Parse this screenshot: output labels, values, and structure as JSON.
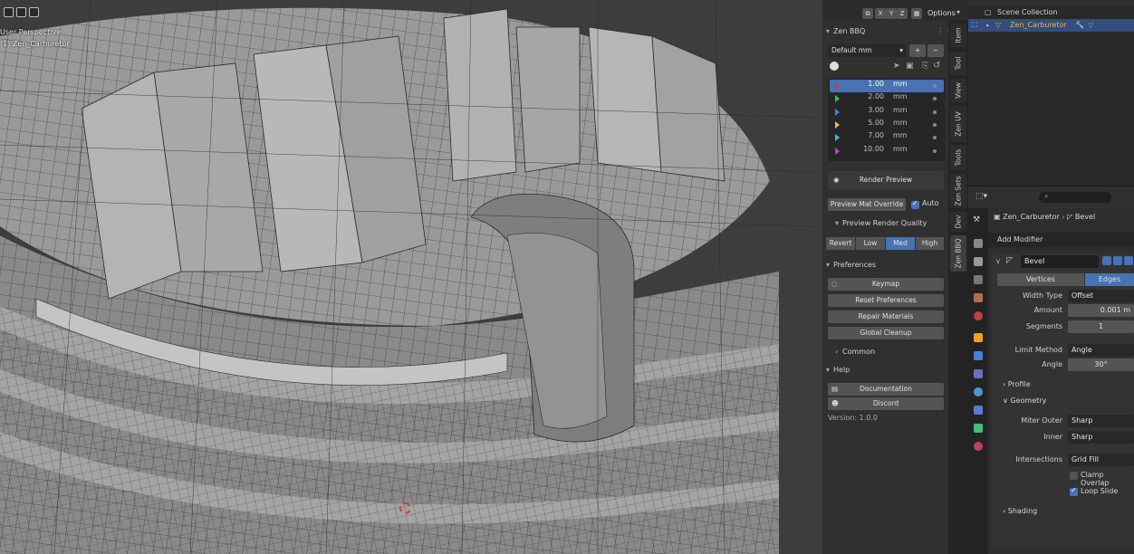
{
  "viewport": {
    "view_label": "User Perspective",
    "object_label": "(1) Zen_Carburetor",
    "options_label": "Options",
    "axes": [
      "X",
      "Y",
      "Z"
    ]
  },
  "zen_bbq": {
    "panel_title": "Zen BBQ",
    "preset": "Default mm",
    "bevel_rows": [
      {
        "value": "1.00",
        "unit": "mm",
        "color": "#e0304a",
        "selected": true
      },
      {
        "value": "2.00",
        "unit": "mm",
        "color": "#3fbf3f",
        "selected": false
      },
      {
        "value": "3.00",
        "unit": "mm",
        "color": "#4a7fe0",
        "selected": false
      },
      {
        "value": "5.00",
        "unit": "mm",
        "color": "#e0c030",
        "selected": false
      },
      {
        "value": "7.00",
        "unit": "mm",
        "color": "#30c0d8",
        "selected": false
      },
      {
        "value": "10.00",
        "unit": "mm",
        "color": "#c040d0",
        "selected": false
      }
    ],
    "render_preview": "Render Preview",
    "preview_mat_override": "Preview Mat Override",
    "auto_label": "Auto",
    "preview_quality_title": "Preview Render Quality",
    "quality_buttons": [
      {
        "label": "Revert",
        "active": false
      },
      {
        "label": "Low",
        "active": false
      },
      {
        "label": "Med",
        "active": true
      },
      {
        "label": "High",
        "active": false
      }
    ],
    "preferences_title": "Preferences",
    "keymap": "Keymap",
    "reset_preferences": "Reset Preferences",
    "repair_materials": "Repair Materials",
    "global_cleanup": "Global Cleanup",
    "common": "Common",
    "help_title": "Help",
    "documentation": "Documentation",
    "discord": "Discord",
    "version": "Version: 1.0.0"
  },
  "side_tabs": [
    "Item",
    "Tool",
    "View",
    "Zen UV",
    "Tools",
    "Zen Sets",
    "Dev",
    "Zen BBQ"
  ],
  "outliner": {
    "scene_collection": "Scene Collection",
    "object": "Zen_Carburetor"
  },
  "properties": {
    "breadcrumb_object": "Zen_Carburetor",
    "breadcrumb_modifier": "Bevel",
    "add_modifier": "Add Modifier",
    "modifier_name": "Bevel",
    "affect_vertices": "Vertices",
    "affect_edges": "Edges",
    "width_type_label": "Width Type",
    "width_type_value": "Offset",
    "amount_label": "Amount",
    "amount_value": "0.001 m",
    "segments_label": "Segments",
    "segments_value": "1",
    "limit_method_label": "Limit Method",
    "limit_method_value": "Angle",
    "angle_label": "Angle",
    "angle_value": "30°",
    "profile_label": "Profile",
    "geometry_label": "Geometry",
    "miter_outer_label": "Miter Outer",
    "miter_outer_value": "Sharp",
    "inner_label": "Inner",
    "inner_value": "Sharp",
    "intersections_label": "Intersections",
    "intersections_value": "Grid Fill",
    "clamp_overlap": "Clamp Overlap",
    "loop_slide": "Loop Slide",
    "shading_label": "Shading"
  }
}
